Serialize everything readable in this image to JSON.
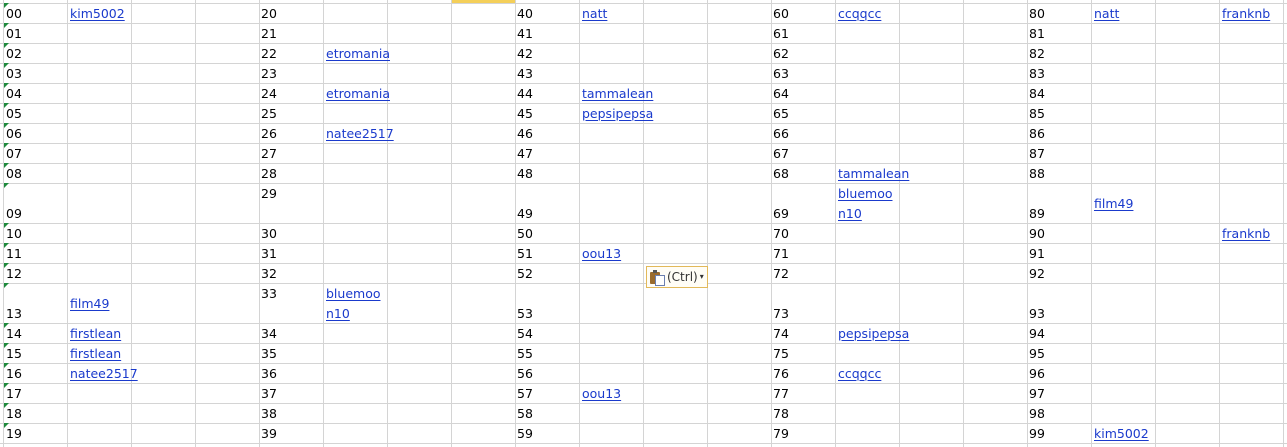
{
  "row_numbers": [
    "00",
    "01",
    "02",
    "03",
    "04",
    "05",
    "06",
    "07",
    "08",
    "09",
    "10",
    "11",
    "12",
    "13",
    "14",
    "15",
    "16",
    "17",
    "18",
    "19",
    "20",
    "21",
    "22",
    "23",
    "24",
    "25",
    "26",
    "27",
    "28",
    "29",
    "30",
    "31",
    "32",
    "33",
    "34",
    "35",
    "36",
    "37",
    "38",
    "39",
    "40",
    "41",
    "42",
    "43",
    "44",
    "45",
    "46",
    "47",
    "48",
    "49",
    "50",
    "51",
    "52",
    "53",
    "54",
    "55",
    "56",
    "57",
    "58",
    "59",
    "60",
    "61",
    "62",
    "63",
    "64",
    "65",
    "66",
    "67",
    "68",
    "69",
    "70",
    "71",
    "72",
    "73",
    "74",
    "75",
    "76",
    "77",
    "78",
    "79",
    "80",
    "81",
    "82",
    "83",
    "84",
    "85",
    "86",
    "87",
    "88",
    "89",
    "90",
    "91",
    "92",
    "93",
    "94",
    "95",
    "96",
    "97",
    "98",
    "99"
  ],
  "names": [
    "kim5002",
    "film49",
    "firstlean",
    "firstlean",
    "natee2517",
    "etromania",
    "etromania",
    "natee2517",
    "bluemoo",
    "n10",
    "natt",
    "tammalean",
    "pepsipepsa",
    "oou13",
    "oou13",
    "ccqqcc",
    "tammalean",
    "bluemoo",
    "n10",
    "pepsipepsa",
    "ccqqcc",
    "natt",
    "franknb",
    "film49",
    "franknb",
    "kim5002"
  ],
  "paste_options": {
    "label": "(Ctrl)",
    "icon": "clipboard-paste-icon",
    "caret": "▾"
  },
  "colors": {
    "link": "#1a3acc",
    "gridline": "#d4d4d4",
    "error_marker": "#1e8a3c",
    "selected_header": "#f4cf59"
  }
}
